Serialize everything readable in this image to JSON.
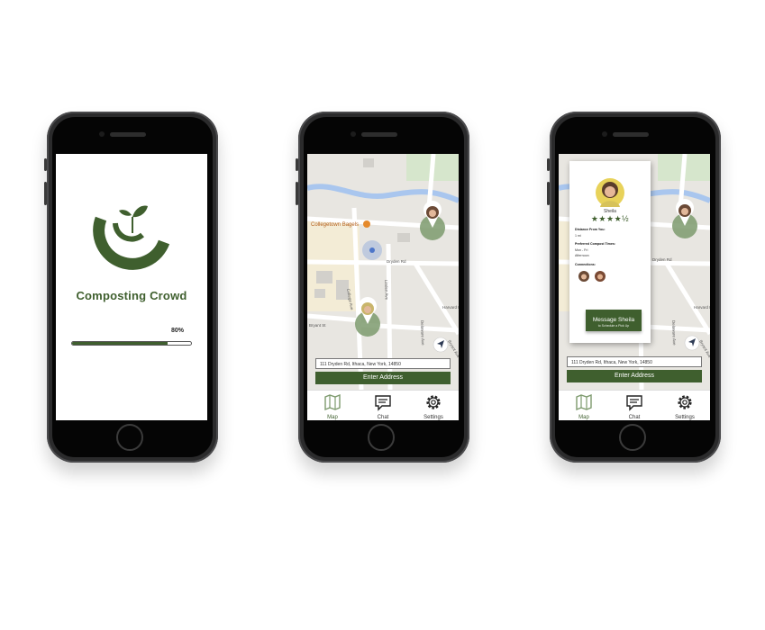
{
  "splash": {
    "app_name": "Composting Crowd",
    "progress_label": "80%",
    "progress_value": 0.8
  },
  "map": {
    "poi_label": "Collegetown Bagels",
    "streets": [
      "Dryden Rd",
      "College Ave",
      "Linden Ave",
      "Bryant St",
      "Harvard Pl",
      "Delaware Ave",
      "Bryant Ave"
    ],
    "address_value": "111 Dryden Rd, Ithaca, New York, 14850",
    "enter_button": "Enter Address"
  },
  "tabs": [
    {
      "label": "Map",
      "icon": "map-icon"
    },
    {
      "label": "Chat",
      "icon": "chat-icon"
    },
    {
      "label": "Settings",
      "icon": "gear-icon"
    }
  ],
  "profile": {
    "name": "Sheila",
    "rating": 4.5,
    "stars": "★★★★½",
    "distance_label": "Distance From You:",
    "distance_value": "1 mi",
    "times_label": "Preferred Compost Times:",
    "times_days": "Mon - Fri",
    "times_period": "Afternoon",
    "connections_label": "Connections:",
    "message_button": "Message Sheila",
    "message_sub": "to Schedule a Pick Up"
  },
  "colors": {
    "brand_green": "#3f5f2e",
    "marker_green": "#7d9a6d",
    "water_blue": "#a9c6ee",
    "map_bg": "#e8e6e1"
  }
}
